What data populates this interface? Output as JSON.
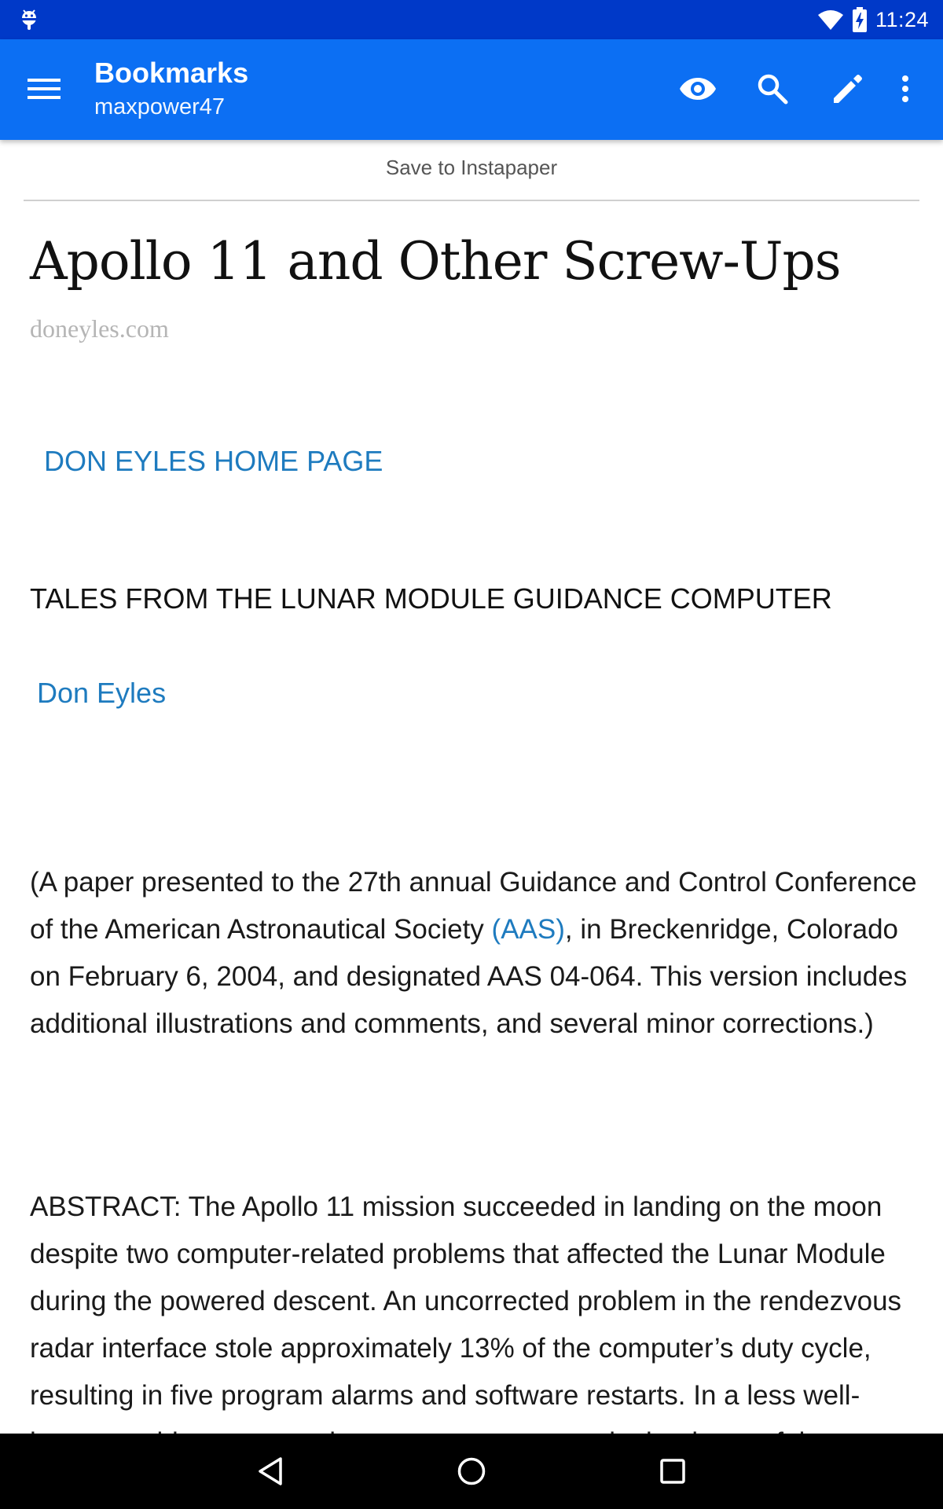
{
  "status_bar": {
    "time": "11:24",
    "icons": [
      "android-debug-icon",
      "wifi-icon",
      "battery-charging-icon"
    ]
  },
  "app_bar": {
    "title": "Bookmarks",
    "subtitle": "maxpower47",
    "actions": [
      "menu-icon",
      "eye-icon",
      "search-icon",
      "edit-pencil-icon",
      "more-vert-icon"
    ],
    "color": "#0c6ff3",
    "status_color": "#0039c8"
  },
  "article": {
    "save_label": "Save to Instapaper",
    "title": "Apollo 11 and Other Screw-Ups",
    "source": "doneyles.com",
    "home_link": "DON EYLES HOME PAGE",
    "heading": "TALES FROM THE LUNAR MODULE GUIDANCE COMPUTER",
    "author": "Don Eyles",
    "para1_before": "(A paper presented to the 27th annual Guidance and Control Conference of the American Astronautical Society ",
    "para1_link": "(AAS)",
    "para1_after": ", in Breckenridge, Colorado on February 6, 2004, and designated AAS 04-064. This version includes additional illustrations and comments, and several minor corrections.)",
    "abstract": "ABSTRACT: The Apollo 11 mission succeeded in landing on the moon despite two computer-related problems that affected the Lunar Module during the powered descent. An uncorrected problem in the rendezvous radar interface stole approximately 13% of the computer’s duty cycle, resulting in five program alarms and software restarts. In a less well-known problem, a wrongly-set mass parameter in the thrust of the",
    "link_color": "#1e7bbf"
  },
  "nav_bar": {
    "buttons": [
      "back-icon",
      "home-icon",
      "recents-icon"
    ]
  }
}
